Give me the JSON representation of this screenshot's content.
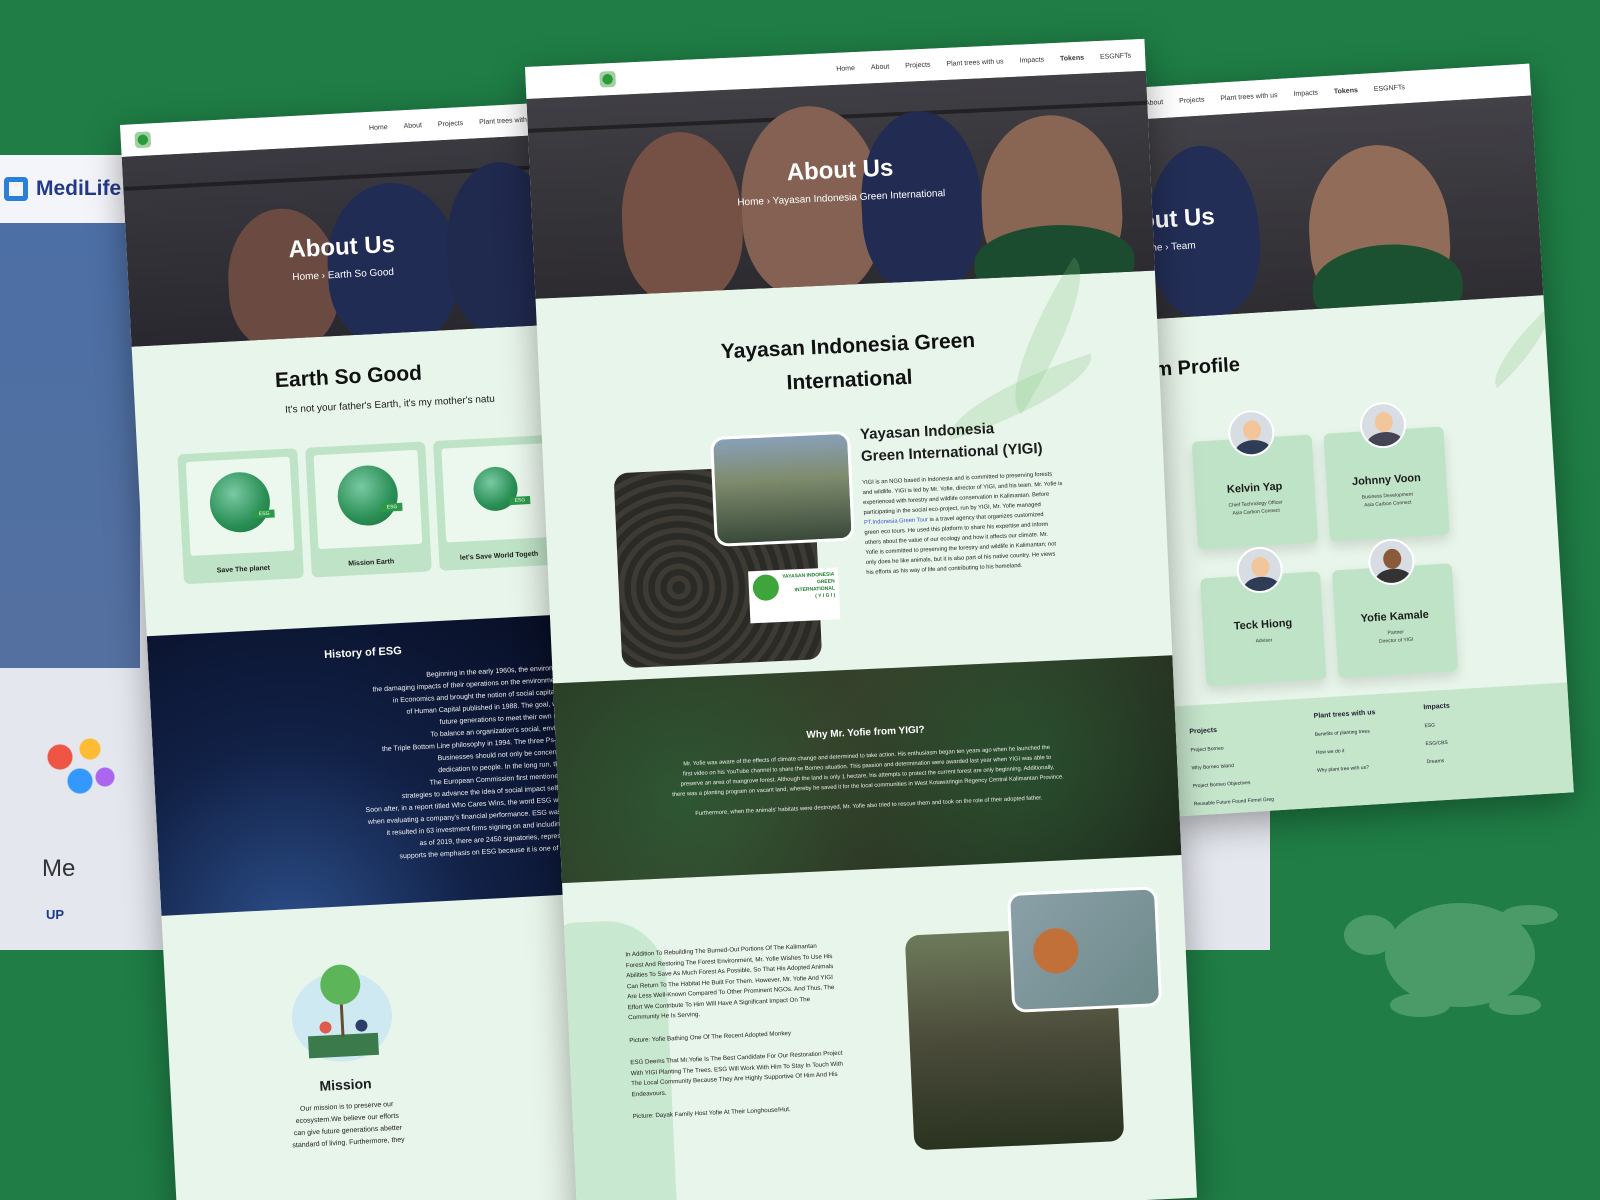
{
  "nav": {
    "home": "Home",
    "about": "About",
    "projects": "Projects",
    "plant": "Plant trees with us",
    "impacts": "Impacts",
    "tokens": "Tokens",
    "esg": "ESGNFTs"
  },
  "medilife": {
    "brand": "MediLife",
    "heading": "Me",
    "sub": "UP"
  },
  "left": {
    "hero_title": "About Us",
    "crumb_home": "Home",
    "crumb_page": "Earth So Good",
    "section_title": "Earth So Good",
    "tagline": "It's not your father's Earth, it's my mother's natu",
    "cards": [
      {
        "label": "Save The planet",
        "tag": "ESG"
      },
      {
        "label": "Mission Earth",
        "tag": "ESG"
      },
      {
        "label": "let's Save World Togeth",
        "tag": "ESG"
      }
    ],
    "history_title": "History of ESG",
    "history": [
      "Beginning in the early 1960s, the environmental movement urged that businesses",
      "the damaging impacts of their operations on the environment. James S. Coleman disputed the pred",
      "in Economics and brought the notion of social capital into the assessment of value in his artic",
      "of Human Capital published in 1988. The goal, which is to meet current demands without",
      "future generations to meet their own requirements, is described as sustainabili",
      "To balance an organization's social, environmental, and economic effects, John E",
      "the Triple Bottom Line philosophy in 1994. The three Ps—profit, people, and the planet—are requ",
      "Businesses should not only be concerned with making a profit, but also with the",
      "dedication to people. In the long run, they should also take steps to improve the",
      "The European Commission first mentioned corporate social responsibility (CSR) in",
      "strategies to advance the idea of social impact self-responsibility while outlining rule-making",
      "Soon after, in a report titled Who Cares Wins, the word ESG was mentioned, and for the first time (2004",
      "when evaluating a company's financial performance. ESG was developed to promote the advancement",
      "it resulted in 63 investment firms signing on and including ESG problems in their $6.5 trillion AUM",
      "as of 2019, there are 2450 signatories, representing an AUM of more than $80 trillion. I",
      "supports the emphasis on ESG because it is one of the primary factors that major institutional"
    ],
    "mission_title": "Mission",
    "mission": [
      "Our mission is to preserve our",
      "ecosystem.We believe our efforts",
      "can give future generations abetter",
      "standard of living. Furthermore, they"
    ]
  },
  "center": {
    "hero_title": "About Us",
    "crumb_home": "Home",
    "crumb_page": "Yayasan Indonesia Green International",
    "section_title_1": "Yayasan Indonesia Green",
    "section_title_2": "International",
    "yigi_title_1": "Yayasan Indonesia",
    "yigi_title_2": "Green International (YIGI)",
    "yigi_logo_1": "YAYASAN INDONESIA",
    "yigi_logo_2": "GREEN INTERNATIONAL",
    "yigi_logo_3": "( Y I G I )",
    "yigi_body": [
      "YIGI is an NGO based in Indonesia and is committed to preserving forests",
      "and wildlife. YIGI is led by Mr. Yofie, director of YIGI, and his team. Mr. Yofie is",
      "experienced with forestry and wildlife conservation in Kalimantan. Before",
      "participating in the social eco-project, run by YIGI, Mr. Yofie managed"
    ],
    "yigi_link": "PT.Indonesia Green Tour",
    "yigi_link_after": " is a travel agency that organizes customized",
    "yigi_body_2": [
      "green eco tours. He used this platform to share his expertise and inform",
      "others about the value of our ecology and how it affects our climate. Mr.",
      "Yofie is committed to preserving the forestry and wildlife in Kalimantan; not",
      "only does he like animals, but it is also part of his native country. He views",
      "his efforts as his way of life and contributing to his homeland."
    ],
    "why_title": "Why Mr. Yofie from YIGI?",
    "why_body": [
      "Mr. Yofie was aware of the effects of climate change and determined to take action. His enthusiasm began ten years ago when he launched the",
      "first video on his YouTube channel to share the Borneo situation. This passion and determination were awarded last year when YIGI was able to",
      "preserve an area of mangrove forest. Although the land is only 1 hectare, his attempts to protect the current forest are only beginning. Additionally,",
      "there was a planting program on vacant land, whereby he saved it for the local communities in West Kotawaringin Regency Central Kalimantan Province.",
      "",
      "Furthermore, when the animals' habitats were destroyed, Mr. Yofie also tried to rescue them and took on the role of their adopted father."
    ],
    "bottom_body": [
      "In Addition To Rebuilding The Burned-Out Portions Of The Kalimantan",
      "Forest And Restoring The Forest Environment, Mr. Yofie Wishes To Use His",
      "Abilities To Save As Much Forest As Possible, So That His Adopted Animals",
      "Can Return To The Habitat He Built For Them. However, Mr. Yofie And YIGI",
      "Are Less Well-Known Compared To Other Prominent NGOs. And Thus, The",
      "Effort We Contribute To Him Will Have A Significant Impact On The",
      "Community He Is Serving."
    ],
    "caption_1": "Picture: Yofie Bathing One Of The Recent Adopted Monkey",
    "bottom_body_2": [
      "ESG Deems That Mr.Yofie Is The Best Candidate For Our Restoration Project",
      "With YIGI Planting The Trees. ESG Will Work With Him To Stay In Touch With",
      "The Local Community Because They Are Highly Supportive Of Him And His",
      "Endeavours."
    ],
    "caption_2": "Picture: Dayak Family Host Yofie At Their Longhouse/Hut."
  },
  "right": {
    "hero_title": "About Us",
    "crumb_home": "Home",
    "crumb_page": "Team",
    "section_title": "am Profile",
    "members": [
      {
        "name": "Kelvin Yap",
        "role_1": "Chief Technology Officer",
        "role_2": "Asia Carbon Connect"
      },
      {
        "name": "Johnny Voon",
        "role_1": "Business Development",
        "role_2": "Asia Carbon Connect"
      },
      {
        "name": "Teck Hiong",
        "role_1": "Advisor",
        "role_2": ""
      },
      {
        "name": "Yofie Kamale",
        "role_1": "Partner",
        "role_2": "Director of YIGI"
      }
    ],
    "footer": {
      "projects_title": "Projects",
      "projects": [
        "Project Borneo",
        "Why Borneo Island",
        "Project Borneo Objectives",
        "Reusable Future Found Firmel Greg",
        "What trees are we planting?"
      ],
      "plant_title": "Plant trees with us",
      "plant": [
        "Benefits of planting trees",
        "How we do it",
        "Why plant tree with us?"
      ],
      "impacts_title": "Impacts",
      "impacts": [
        "ESG",
        "ESG/CBS",
        "Dreams"
      ]
    }
  },
  "colors": {
    "bg": "#1f7d45",
    "panel": "#e8f5ea",
    "card": "#bfe3c7",
    "accent": "#2a9a47"
  }
}
